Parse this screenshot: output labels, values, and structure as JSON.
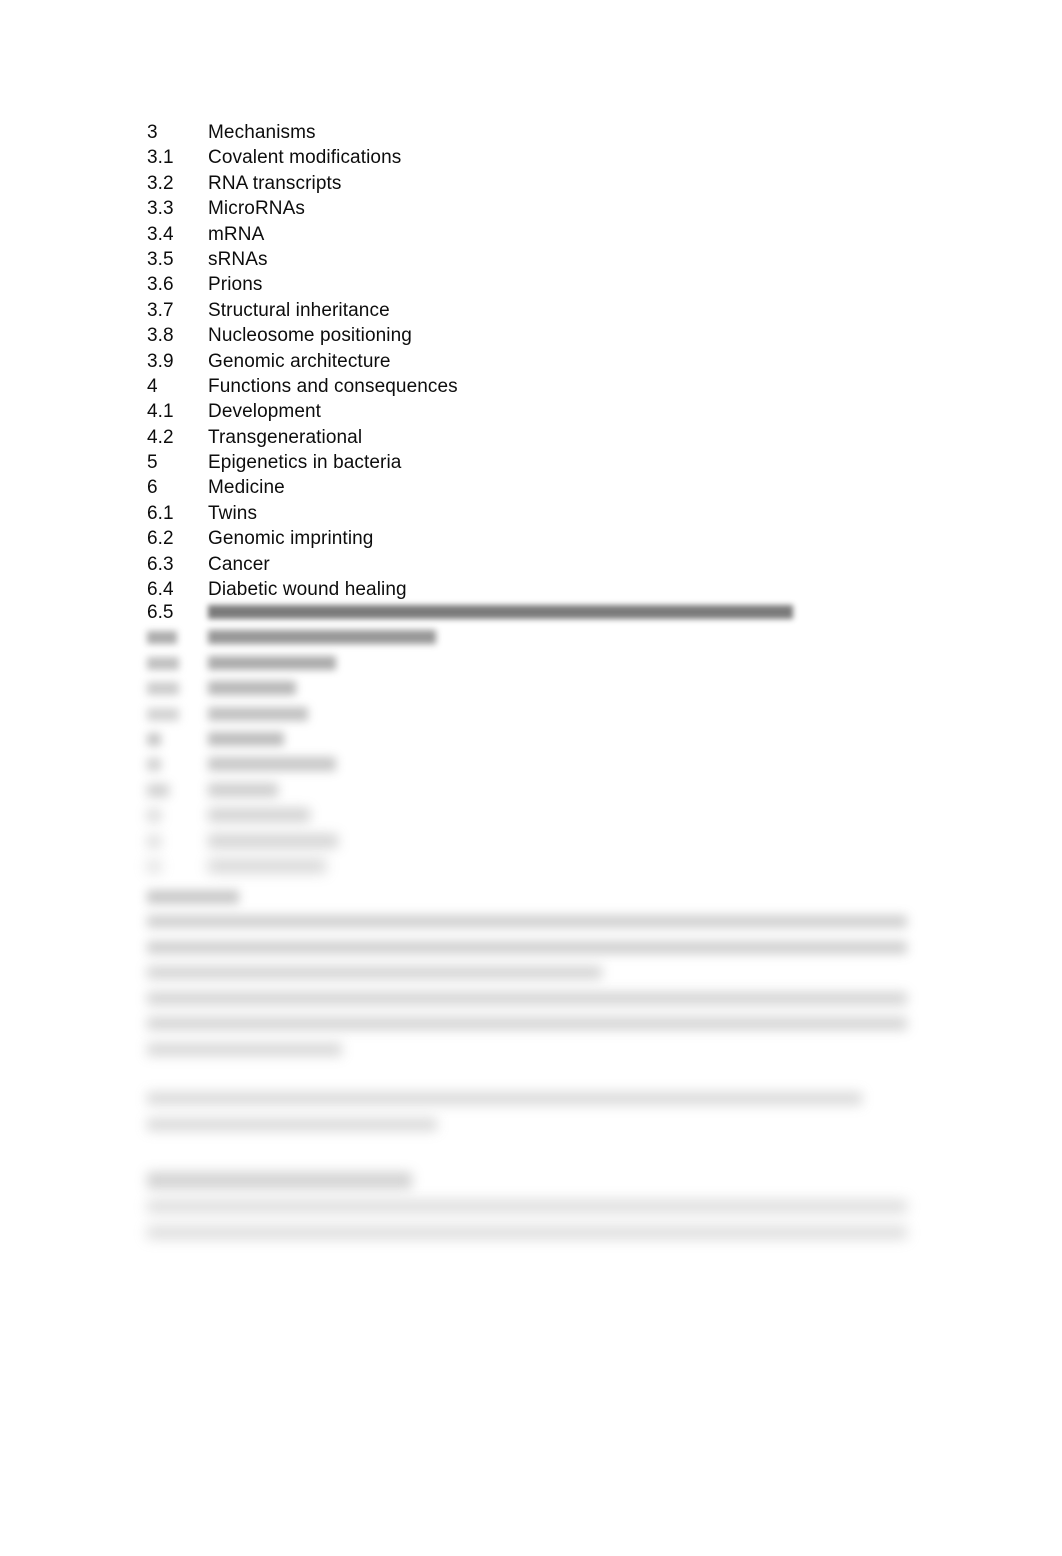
{
  "document": {
    "page_background": "#ffffff",
    "text_color": "#0d0d0d",
    "type": "word-processor-page",
    "legible_region_note": "table-of-contents entries 3 through 6.4 are rendered sharply",
    "blurred_region_note": "content from entry 6.5 onward is blurred and unreadable"
  },
  "toc": {
    "entries": [
      {
        "number": "3",
        "label": "Mechanisms"
      },
      {
        "number": "3.1",
        "label": "Covalent modifications"
      },
      {
        "number": "3.2",
        "label": "RNA transcripts"
      },
      {
        "number": "3.3",
        "label": "MicroRNAs"
      },
      {
        "number": "3.4",
        "label": "mRNA"
      },
      {
        "number": "3.5",
        "label": "sRNAs"
      },
      {
        "number": "3.6",
        "label": "Prions"
      },
      {
        "number": "3.7",
        "label": "Structural inheritance"
      },
      {
        "number": "3.8",
        "label": "Nucleosome positioning"
      },
      {
        "number": "3.9",
        "label": "Genomic architecture"
      },
      {
        "number": "4",
        "label": "Functions and consequences"
      },
      {
        "number": "4.1",
        "label": "Development"
      },
      {
        "number": "4.2",
        "label": "Transgenerational"
      },
      {
        "number": "5",
        "label": "Epigenetics in bacteria"
      },
      {
        "number": "6",
        "label": "Medicine"
      },
      {
        "number": "6.1",
        "label": "Twins"
      },
      {
        "number": "6.2",
        "label": "Genomic imprinting"
      },
      {
        "number": "6.3",
        "label": "Cancer"
      },
      {
        "number": "6.4",
        "label": "Diabetic wound healing"
      }
    ]
  },
  "toc_blurred": {
    "entries": [
      {
        "number": "6.5",
        "number_legible": true,
        "label_width": 585
      },
      {
        "number": "",
        "number_legible": false,
        "label_width": 228
      },
      {
        "number": "",
        "number_legible": false,
        "label_width": 128
      },
      {
        "number": "",
        "number_legible": false,
        "label_width": 88
      },
      {
        "number": "",
        "number_legible": false,
        "label_width": 100
      },
      {
        "number": "",
        "number_legible": false,
        "label_width": 76
      },
      {
        "number": "",
        "number_legible": false,
        "label_width": 128
      },
      {
        "number": "",
        "number_legible": false,
        "label_width": 70
      },
      {
        "number": "",
        "number_legible": false,
        "label_width": 102
      },
      {
        "number": "",
        "number_legible": false,
        "label_width": 130
      },
      {
        "number": "",
        "number_legible": false,
        "label_width": 118
      }
    ]
  },
  "body_blurred": {
    "short_heading_width": 92,
    "paragraph_1_lines": [
      760,
      760,
      455,
      760,
      760,
      195
    ],
    "paragraph_2_lines": [
      715,
      290
    ],
    "section_heading_width": 265,
    "paragraph_3_lines": [
      760,
      760
    ]
  }
}
